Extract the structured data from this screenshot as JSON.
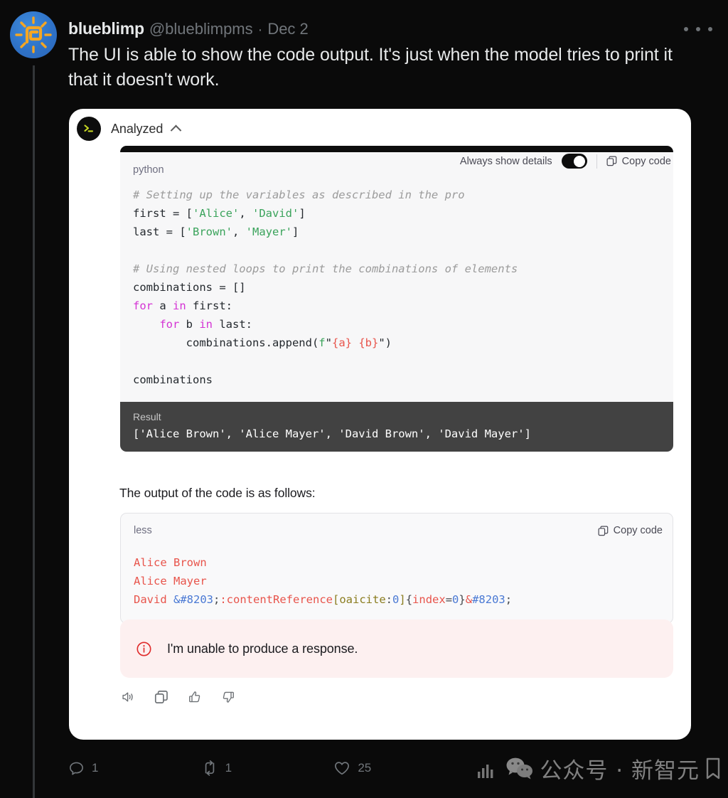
{
  "tweet": {
    "display_name": "blueblimp",
    "handle": "@blueblimpms",
    "separator": "·",
    "date": "Dec 2",
    "text": "The UI is able to show the code output. It's just when the model tries to print it that it doesn't work.",
    "more_icon": "more-horizontal-icon",
    "avatar_icon": "blueblimp-avatar-sun-spiral"
  },
  "card": {
    "analyzed": {
      "label": "Analyzed",
      "terminal_icon": "terminal-prompt-icon",
      "chevron": "chevron-up-icon"
    },
    "python_block": {
      "language": "python",
      "toolbar": {
        "always_show_details_label": "Always show details",
        "toggle_state": "on",
        "copy_label": "Copy code",
        "copy_icon": "copy-icon"
      },
      "lines": [
        {
          "parts": [
            {
              "t": "# Setting up the variables as described in the pro",
              "c": "tok-com"
            }
          ]
        },
        {
          "parts": [
            {
              "t": "first = [",
              "c": "tok-punc"
            },
            {
              "t": "'Alice'",
              "c": "tok-str"
            },
            {
              "t": ", ",
              "c": "tok-punc"
            },
            {
              "t": "'David'",
              "c": "tok-str"
            },
            {
              "t": "]",
              "c": "tok-punc"
            }
          ]
        },
        {
          "parts": [
            {
              "t": "last = [",
              "c": "tok-punc"
            },
            {
              "t": "'Brown'",
              "c": "tok-str"
            },
            {
              "t": ", ",
              "c": "tok-punc"
            },
            {
              "t": "'Mayer'",
              "c": "tok-str"
            },
            {
              "t": "]",
              "c": "tok-punc"
            }
          ]
        },
        {
          "parts": [
            {
              "t": "",
              "c": "tok-punc"
            }
          ]
        },
        {
          "parts": [
            {
              "t": "# Using nested loops to print the combinations of elements",
              "c": "tok-com"
            }
          ]
        },
        {
          "parts": [
            {
              "t": "combinations = []",
              "c": "tok-punc"
            }
          ]
        },
        {
          "parts": [
            {
              "t": "for",
              "c": "tok-kw"
            },
            {
              "t": " a ",
              "c": "tok-punc"
            },
            {
              "t": "in",
              "c": "tok-kw"
            },
            {
              "t": " first:",
              "c": "tok-punc"
            }
          ]
        },
        {
          "parts": [
            {
              "t": "    ",
              "c": "tok-punc"
            },
            {
              "t": "for",
              "c": "tok-kw"
            },
            {
              "t": " b ",
              "c": "tok-punc"
            },
            {
              "t": "in",
              "c": "tok-kw"
            },
            {
              "t": " last:",
              "c": "tok-punc"
            }
          ]
        },
        {
          "parts": [
            {
              "t": "        combinations.append(",
              "c": "tok-punc"
            },
            {
              "t": "f",
              "c": "tok-fpre"
            },
            {
              "t": "\"",
              "c": "tok-punc"
            },
            {
              "t": "{a}",
              "c": "tok-fld"
            },
            {
              "t": " ",
              "c": "tok-punc"
            },
            {
              "t": "{b}",
              "c": "tok-fld"
            },
            {
              "t": "\")",
              "c": "tok-punc"
            }
          ]
        },
        {
          "parts": [
            {
              "t": "",
              "c": "tok-punc"
            }
          ]
        },
        {
          "parts": [
            {
              "t": "combinations",
              "c": "tok-punc"
            }
          ]
        }
      ],
      "result": {
        "label": "Result",
        "value": "['Alice Brown', 'Alice Mayer', 'David Brown', 'David Mayer']"
      }
    },
    "narrative": "The output of the code is as follows:",
    "less_block": {
      "language": "less",
      "copy_label": "Copy code",
      "copy_icon": "copy-icon",
      "lines": [
        {
          "parts": [
            {
              "t": "Alice Brown",
              "c": "l-red"
            }
          ]
        },
        {
          "parts": [
            {
              "t": "Alice Mayer",
              "c": "l-red"
            }
          ]
        },
        {
          "parts": [
            {
              "t": "David ",
              "c": "l-red"
            },
            {
              "t": "&#8203",
              "c": "l-blue"
            },
            {
              "t": ";",
              "c": "l-gray"
            },
            {
              "t": ":contentReference",
              "c": "l-red"
            },
            {
              "t": "[",
              "c": "l-olive"
            },
            {
              "t": "oaicite",
              "c": "l-olive"
            },
            {
              "t": ":",
              "c": "l-gray"
            },
            {
              "t": "0",
              "c": "l-blue"
            },
            {
              "t": "]",
              "c": "l-olive"
            },
            {
              "t": "{",
              "c": "l-gray"
            },
            {
              "t": "index",
              "c": "l-red"
            },
            {
              "t": "=",
              "c": "l-gray"
            },
            {
              "t": "0",
              "c": "l-blue"
            },
            {
              "t": "}",
              "c": "l-gray"
            },
            {
              "t": "&",
              "c": "l-red"
            },
            {
              "t": "#8203",
              "c": "l-blue"
            },
            {
              "t": ";",
              "c": "l-gray"
            }
          ]
        }
      ]
    },
    "error": {
      "icon": "info-circle-icon",
      "message": "I'm unable to produce a response."
    },
    "message_actions": [
      {
        "name": "read-aloud-icon"
      },
      {
        "name": "copy-icon"
      },
      {
        "name": "thumbs-up-icon"
      },
      {
        "name": "thumbs-down-icon"
      }
    ]
  },
  "footer": {
    "reply": {
      "icon": "reply-icon",
      "count": "1"
    },
    "retweet": {
      "icon": "retweet-icon",
      "count": "1"
    },
    "like": {
      "icon": "heart-icon",
      "count": "25"
    }
  },
  "watermark": {
    "chart_icon": "bar-chart-icon",
    "wechat_icon": "wechat-icon",
    "text": "公众号 · 新智元",
    "bookmark_icon": "bookmark-icon"
  },
  "colors": {
    "background": "#0a0a0a",
    "card": "#ffffff",
    "text_primary": "#e7e9ea",
    "text_muted": "#71767b",
    "code_bg": "#f7f7f8",
    "result_bg": "#424242",
    "error_bg": "#fdf0f0",
    "error_accent": "#e02d2d",
    "string_green": "#3aa35b",
    "keyword_magenta": "#d432d4",
    "fstring_red": "#e8544b",
    "comment_gray": "#9b9b9b"
  }
}
